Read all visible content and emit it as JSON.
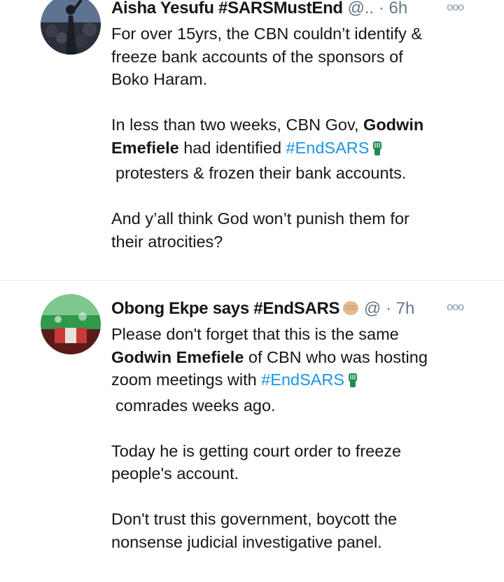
{
  "tweets": [
    {
      "name": "Aisha Yesufu #SARSMustEnd",
      "handle": "@..",
      "time": "· 6h",
      "more": "ooo",
      "lines": {
        "p1a": "For over 15yrs, the CBN couldn’t identify &",
        "p1b": "freeze bank accounts of the sponsors of",
        "p1c": "Boko Haram.",
        "p2a_pre": "In less than two weeks, CBN Gov, ",
        "p2a_bold": "Godwin",
        "p2b_bold": "Emefiele",
        "p2b_mid": " had identified ",
        "p2b_tag": "#EndSARS",
        "p2c": "protesters & frozen their bank accounts.",
        "p3a": "And y’all think God won’t punish them for",
        "p3b": "their atrocities?"
      }
    },
    {
      "name": "Obong Ekpe says #EndSARS",
      "handle": "@",
      "time": "· 7h",
      "more": "ooo",
      "lines": {
        "p1a": "Please don't forget that this is the same",
        "p1b_bold": "Godwin Emefiele",
        "p1b_rest": " of CBN who was hosting",
        "p1c_pre": "zoom meetings with ",
        "p1c_tag": "#EndSARS",
        "p1d": "comrades weeks ago.",
        "p2a": "Today he is getting court order to freeze",
        "p2b": "people's account.",
        "p3a": "Don't trust this government, boycott the",
        "p3b": "nonsense judicial investigative panel."
      }
    }
  ],
  "colors": {
    "hashtag": "#1b95e0",
    "secondary": "#657786",
    "fist": "#1e8a4e"
  },
  "icons": [
    "raised-fist-green-icon",
    "raised-fist-tan-icon",
    "more-options-icon"
  ]
}
